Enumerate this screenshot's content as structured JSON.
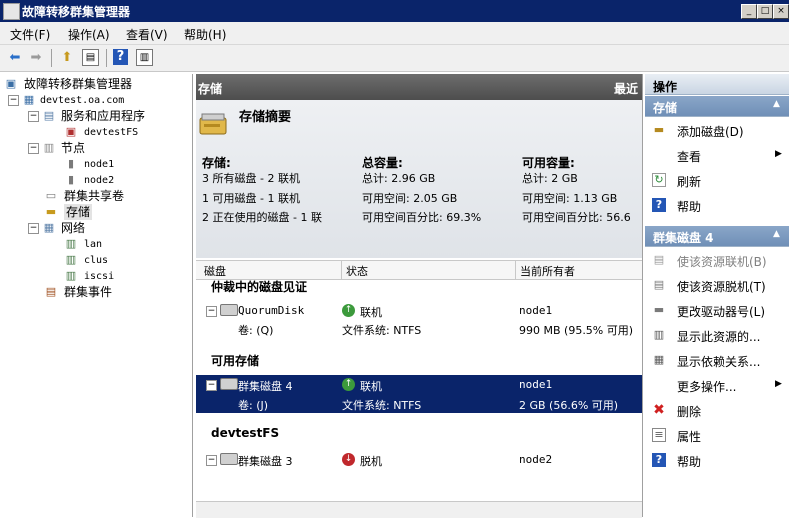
{
  "window": {
    "title": "故障转移群集管理器",
    "controls": [
      "_",
      "□",
      "×"
    ]
  },
  "menubar": {
    "items": [
      "文件(F)",
      "操作(A)",
      "查看(V)",
      "帮助(H)"
    ]
  },
  "tree": {
    "root": "故障转移群集管理器",
    "cluster": "devtest.oa.com",
    "services": "服务和应用程序",
    "service_item": "devtestFS",
    "nodes": "节点",
    "node1": "node1",
    "node2": "node2",
    "shared": "群集共享卷",
    "storage": "存储",
    "network": "网络",
    "net1": "lan",
    "net2": "clus",
    "net3": "iscsi",
    "events": "群集事件"
  },
  "center": {
    "header_title": "存储",
    "header_right": "最近",
    "summary_title": "存储摘要",
    "storage": {
      "label": "存储:",
      "lines": [
        "3 所有磁盘 - 2 联机",
        "1 可用磁盘 - 1 联机",
        "2 正在使用的磁盘 - 1 联"
      ]
    },
    "total": {
      "label": "总容量:",
      "lines": [
        "总计: 2.96 GB",
        "可用空间: 2.05 GB",
        "可用空间百分比: 69.3%"
      ]
    },
    "available": {
      "label": "可用容量:",
      "lines": [
        "总计: 2 GB",
        "可用空间: 1.13 GB",
        "可用空间百分比: 56.6"
      ]
    },
    "columns": [
      "磁盘",
      "状态",
      "当前所有者"
    ],
    "groups": {
      "witness": "仲裁中的磁盘见证",
      "available": "可用存储",
      "fs": "devtestFS"
    },
    "rows": {
      "quorum_disk": "QuorumDisk",
      "quorum_status": "联机",
      "quorum_owner": "node1",
      "quorum_vol": "卷: (Q)",
      "quorum_fs": "文件系统: NTFS",
      "quorum_free": "990 MB (95.5% 可用)",
      "disk4": "群集磁盘 4",
      "disk4_status": "联机",
      "disk4_owner": "node1",
      "disk4_vol": "卷: (J)",
      "disk4_fs": "文件系统: NTFS",
      "disk4_free": "2 GB (56.6% 可用)",
      "disk3": "群集磁盘 3",
      "disk3_status": "脱机",
      "disk3_owner": "node2"
    }
  },
  "actions": {
    "header": "操作",
    "sec1": "存储",
    "sec1_items": [
      "添加磁盘(D)",
      "查看",
      "刷新",
      "帮助"
    ],
    "sec2": "群集磁盘 4",
    "sec2_items": [
      "使该资源联机(B)",
      "使该资源脱机(T)",
      "更改驱动器号(L)",
      "显示此资源的...",
      "显示依赖关系...",
      "更多操作...",
      "删除",
      "属性",
      "帮助"
    ]
  },
  "colors": {
    "title_bar": "#0a246a",
    "selection": "#0a246a",
    "online_green": "#3c9a3c",
    "offline_red": "#c0282c"
  }
}
